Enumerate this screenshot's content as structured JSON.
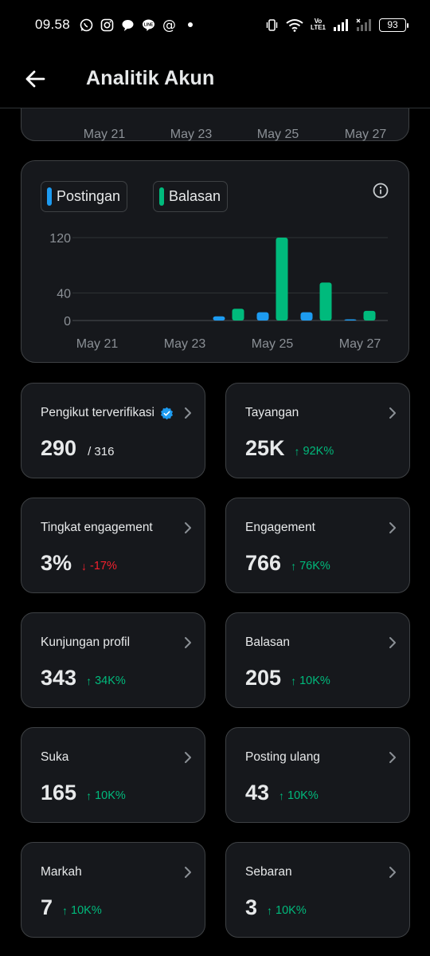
{
  "status_bar": {
    "time": "09.58",
    "battery": "93",
    "volte_top": "Vo",
    "volte_bottom": "LTE1"
  },
  "header": {
    "title": "Analitik Akun",
    "back_icon": "arrow-left-icon"
  },
  "top_chart": {
    "x_labels": [
      "May 21",
      "May 23",
      "May 25",
      "May 27"
    ]
  },
  "chart_data": {
    "type": "bar",
    "legend": [
      "Postingan",
      "Balasan"
    ],
    "y_ticks": [
      0,
      40,
      120
    ],
    "ylim": [
      0,
      125
    ],
    "x_labels": [
      "May 21",
      "May 23",
      "May 25",
      "May 27"
    ],
    "grid": true,
    "colors": {
      "Postingan": "#1d9bf0",
      "Balasan": "#00ba7c"
    },
    "series": [
      {
        "name": "Postingan",
        "days": [
          "May 24",
          "May 25",
          "May 26",
          "May 27"
        ],
        "values": [
          6,
          12,
          12,
          1
        ]
      },
      {
        "name": "Balasan",
        "days": [
          "May 24",
          "May 25",
          "May 26",
          "May 27"
        ],
        "values": [
          17,
          120,
          55,
          14
        ]
      }
    ]
  },
  "metrics": [
    {
      "label": "Pengikut terverifikasi",
      "value": "290",
      "sub": "/ 316",
      "verified": true
    },
    {
      "label": "Tayangan",
      "value": "25K",
      "change": "92K%",
      "direction": "up"
    },
    {
      "label": "Tingkat engagement",
      "value": "3%",
      "change": "-17%",
      "direction": "down"
    },
    {
      "label": "Engagement",
      "value": "766",
      "change": "76K%",
      "direction": "up"
    },
    {
      "label": "Kunjungan profil",
      "value": "343",
      "change": "34K%",
      "direction": "up"
    },
    {
      "label": "Balasan",
      "value": "205",
      "change": "10K%",
      "direction": "up"
    },
    {
      "label": "Suka",
      "value": "165",
      "change": "10K%",
      "direction": "up"
    },
    {
      "label": "Posting ulang",
      "value": "43",
      "change": "10K%",
      "direction": "up"
    },
    {
      "label": "Markah",
      "value": "7",
      "change": "10K%",
      "direction": "up"
    },
    {
      "label": "Sebaran",
      "value": "3",
      "change": "10K%",
      "direction": "up"
    }
  ],
  "colors": {
    "up": "#00ba7c",
    "down": "#f4212e",
    "verified": "#1d9bf0"
  }
}
